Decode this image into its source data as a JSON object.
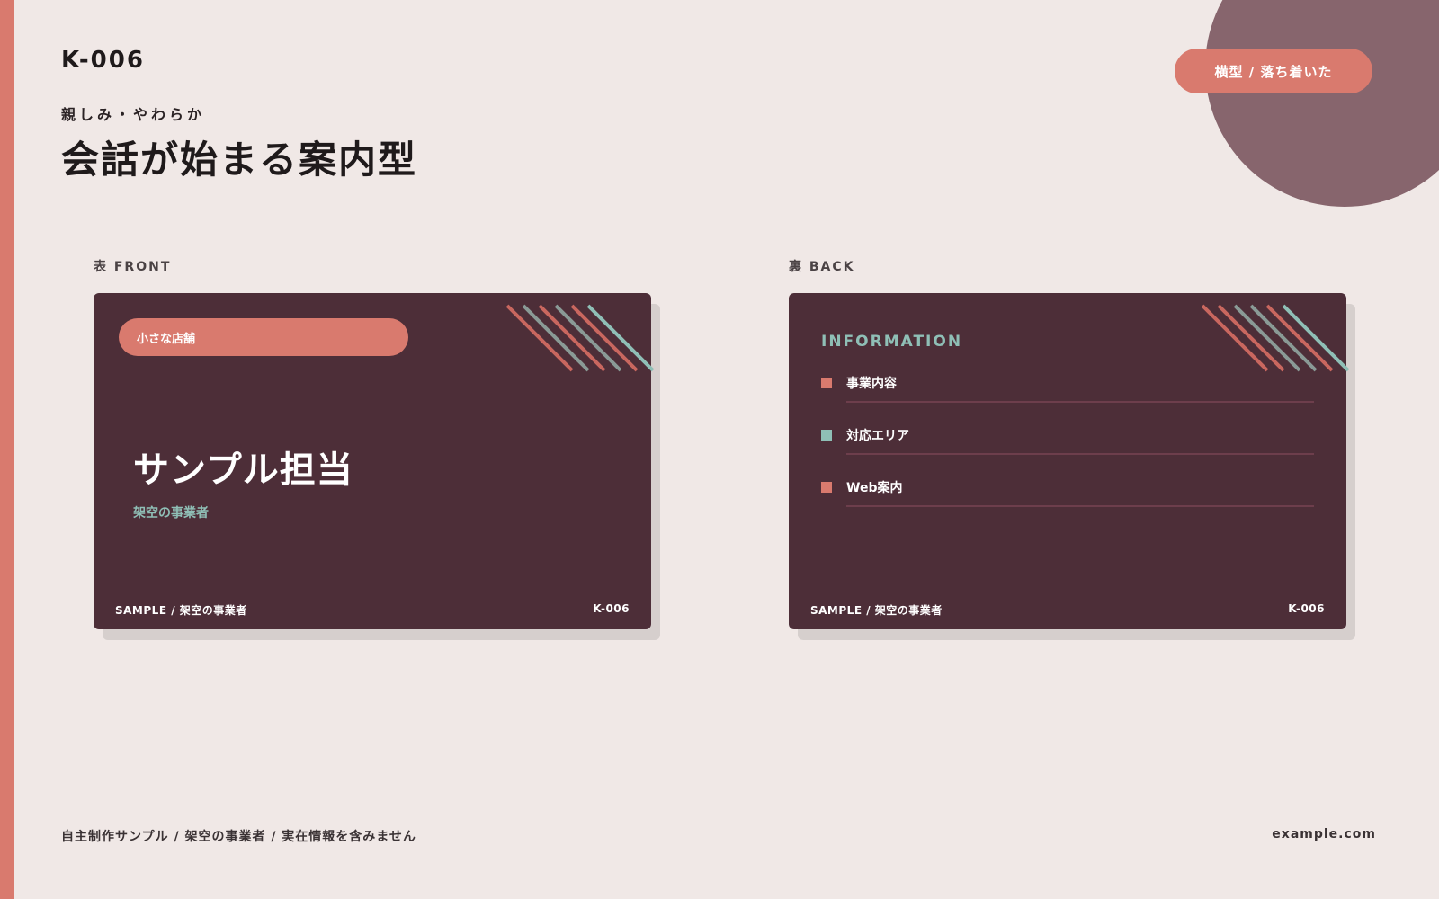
{
  "colors": {
    "background": "#f0e8e6",
    "accent": "#d97a6e",
    "card": "#4d2e38",
    "teal": "#8fbfb6",
    "circle": "#87656d"
  },
  "header": {
    "code": "K-006",
    "subtitle": "親しみ・やわらか",
    "title": "会話が始まる案内型",
    "style_tag": "横型 / 落ち着いた"
  },
  "front": {
    "section_label": "表 FRONT",
    "category": "小さな店舗",
    "person_name": "サンプル担当",
    "business_name": "架空の事業者",
    "footer_left": "SAMPLE / 架空の事業者",
    "footer_right": "K-006"
  },
  "back": {
    "section_label": "裏 BACK",
    "heading": "INFORMATION",
    "items": [
      {
        "label": "事業内容",
        "marker_color": "#d97a6e"
      },
      {
        "label": "対応エリア",
        "marker_color": "#8fbfb6"
      },
      {
        "label": "Web案内",
        "marker_color": "#d97a6e"
      }
    ],
    "footer_left": "SAMPLE / 架空の事業者",
    "footer_right": "K-006"
  },
  "footer": {
    "note": "自主制作サンプル / 架空の事業者 / 実在情報を含みません",
    "domain": "example.com"
  }
}
